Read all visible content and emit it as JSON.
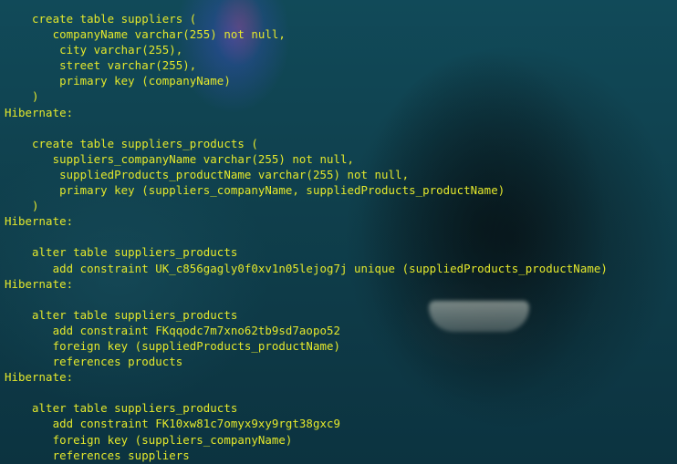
{
  "terminal": {
    "lines": [
      "    create table suppliers (",
      "       companyName varchar(255) not null,",
      "        city varchar(255),",
      "        street varchar(255),",
      "        primary key (companyName)",
      "    )",
      "Hibernate: ",
      "",
      "    create table suppliers_products (",
      "       suppliers_companyName varchar(255) not null,",
      "        suppliedProducts_productName varchar(255) not null,",
      "        primary key (suppliers_companyName, suppliedProducts_productName)",
      "    )",
      "Hibernate: ",
      "",
      "    alter table suppliers_products",
      "       add constraint UK_c856gagly0f0xv1n05lejog7j unique (suppliedProducts_productName)",
      "Hibernate: ",
      "",
      "    alter table suppliers_products",
      "       add constraint FKqqodc7m7xno62tb9sd7aopo52",
      "       foreign key (suppliedProducts_productName)",
      "       references products",
      "Hibernate: ",
      "",
      "    alter table suppliers_products",
      "       add constraint FK10xw81c7omyx9xy9rgt38gxc9",
      "       foreign key (suppliers_companyName)",
      "       references suppliers"
    ]
  },
  "colors": {
    "text": "#e4e82c",
    "background": "#114a59"
  }
}
